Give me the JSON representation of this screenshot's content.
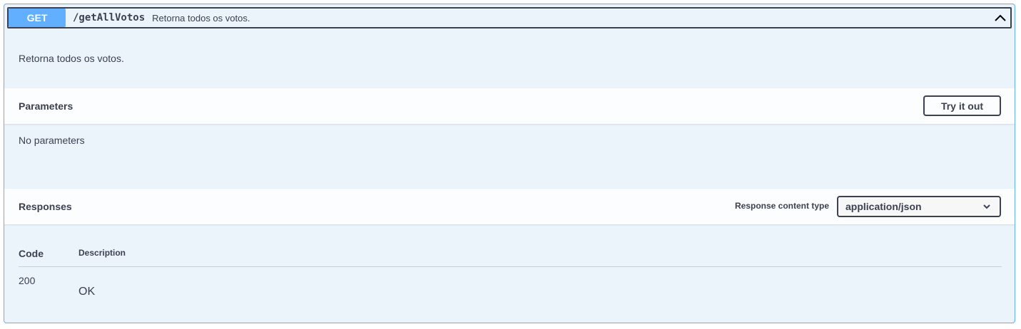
{
  "operation": {
    "method": "GET",
    "path": "/getAllVotos",
    "summary": "Retorna todos os votos.",
    "description": "Retorna todos os votos.",
    "method_color": "#61affe"
  },
  "parameters": {
    "title": "Parameters",
    "try_label": "Try it out",
    "empty_text": "No parameters"
  },
  "responses": {
    "title": "Responses",
    "content_type_label": "Response content type",
    "content_type_value": "application/json",
    "columns": {
      "code": "Code",
      "description": "Description"
    },
    "rows": [
      {
        "code": "200",
        "description": "OK"
      }
    ]
  }
}
